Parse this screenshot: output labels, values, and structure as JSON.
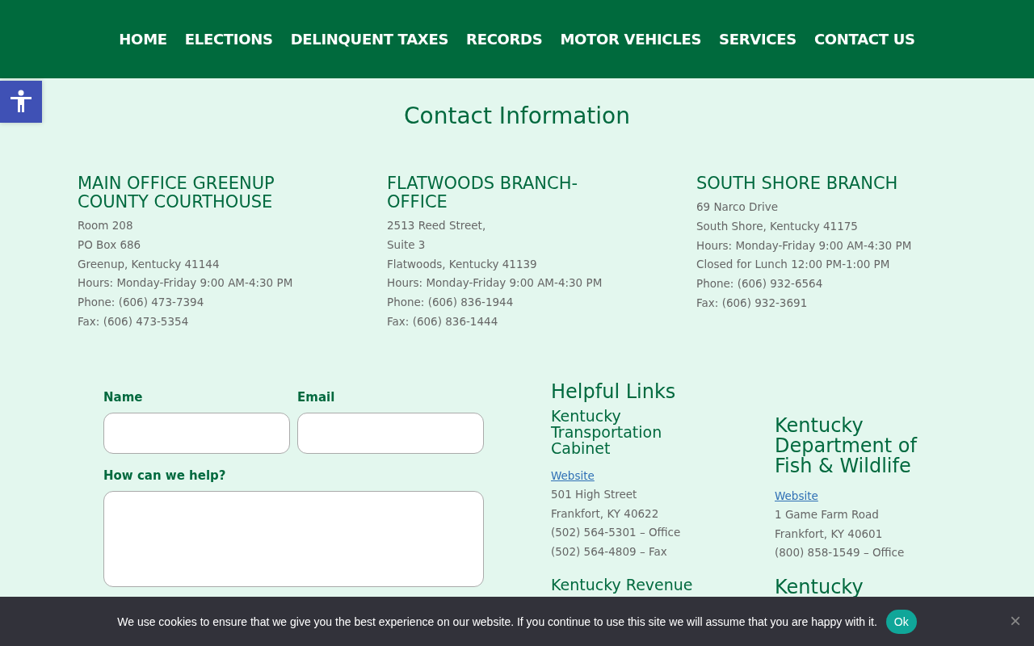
{
  "nav": [
    {
      "label": "HOME"
    },
    {
      "label": "ELECTIONS"
    },
    {
      "label": "DELINQUENT TAXES"
    },
    {
      "label": "RECORDS"
    },
    {
      "label": "MOTOR VEHICLES"
    },
    {
      "label": "SERVICES"
    },
    {
      "label": "CONTACT US"
    }
  ],
  "page_title": "Contact Information",
  "offices": [
    {
      "title": "MAIN OFFICE GREENUP COUNTY COURTHOUSE",
      "lines": [
        "Room 208",
        "PO Box 686",
        "Greenup, Kentucky 41144",
        "Hours: Monday-Friday 9:00 AM-4:30 PM",
        "Phone: (606) 473-7394",
        "Fax: (606) 473-5354"
      ]
    },
    {
      "title": "FLATWOODS BRANCH-OFFICE",
      "lines": [
        "2513 Reed Street,",
        "Suite 3",
        "Flatwoods, Kentucky 41139",
        "Hours: Monday-Friday 9:00 AM-4:30 PM",
        "Phone: (606) 836-1944",
        "Fax: (606) 836-1444"
      ]
    },
    {
      "title": "SOUTH SHORE BRANCH",
      "lines": [
        "69 Narco Drive",
        "South Shore, Kentucky 41175",
        "Hours: Monday-Friday 9:00 AM-4:30 PM",
        "Closed for Lunch 12:00 PM-1:00 PM",
        "Phone: (606) 932-6564",
        "Fax: (606) 932-3691"
      ]
    }
  ],
  "form": {
    "name_label": "Name",
    "email_label": "Email",
    "message_label": "How can we help?"
  },
  "helpful_links": {
    "title": "Helpful Links",
    "columns": [
      [
        {
          "title": "Kentucky Transportation Cabinet",
          "link": "Website",
          "lines": [
            "501 High Street",
            "Frankfort, KY 40622",
            "(502) 564-5301 – Office",
            "(502) 564-4809 – Fax"
          ]
        },
        {
          "title": "Kentucky Revenue"
        }
      ],
      [
        {
          "title": "Kentucky Department of Fish & Wildlife",
          "link": "Website",
          "lines": [
            "1 Game Farm Road",
            "Frankfort, KY 40601",
            "(800) 858-1549 – Office"
          ]
        },
        {
          "title": "Kentucky"
        }
      ]
    ]
  },
  "cookie_bar": {
    "message": "We use cookies to ensure that we give you the best experience on our website. If you continue to use this site we will assume that you are happy with it.",
    "ok": "Ok",
    "close": "×"
  }
}
